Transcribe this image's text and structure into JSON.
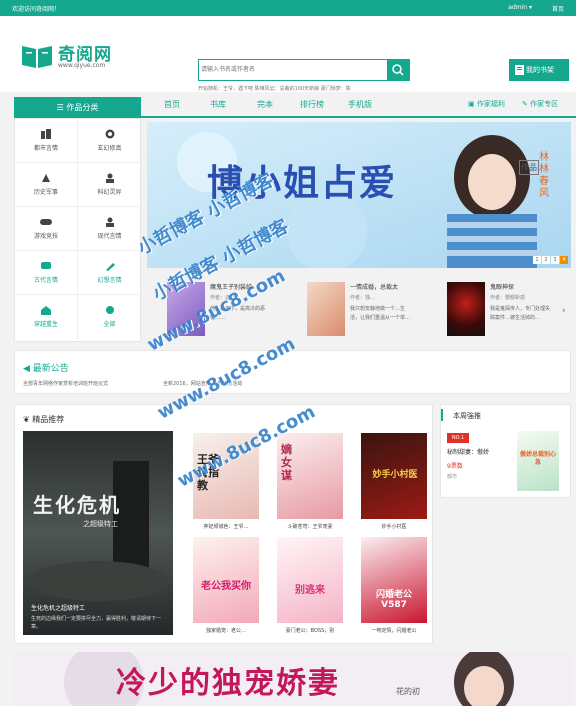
{
  "topbar": {
    "welcome": "欢迎访问奇阅网！",
    "account": "admin ▾",
    "home": "首页"
  },
  "logo": {
    "name": "奇阅网",
    "url": "www.qiyue.com"
  },
  "search": {
    "placeholder": "请输入书名或作者名",
    "hot_words": "开始随机：王爷，遇下吧  陈维风云：总裁的100天新娘 豪门惊梦：陈"
  },
  "shelf": {
    "label": "我的书架"
  },
  "nav": {
    "category": "作品分类",
    "items": [
      "首页",
      "书库",
      "完本",
      "排行榜",
      "手机版"
    ],
    "author_welfare": "作家福利",
    "author_zone": "作家专区"
  },
  "categories": [
    "都市言情",
    "玄幻修真",
    "历史军事",
    "科幻灵异",
    "游戏竞技",
    "现代言情",
    "古代言情",
    "幻想言情",
    "穿越重生",
    "全部"
  ],
  "banner": {
    "title": "博小姐占爱",
    "tag": "作品",
    "author": "林林春风"
  },
  "slider_dots": [
    "1",
    "2",
    "3",
    "4"
  ],
  "featured": [
    {
      "title": "魔鬼王子别装纯",
      "author": "作者：这里",
      "desc": "他，是王子，是高冷的恶魔……"
    },
    {
      "title": "一情成婚，总裁太",
      "author": "作者：独…",
      "desc": "我只想安静地做一个…生活，让我们重温从一个单…"
    },
    {
      "title": "鬼眼神探",
      "author": "作者：酆都斩孤",
      "desc": "我是鬼探传人，专门处理失踪案件…被生活掉的…"
    }
  ],
  "notice": {
    "title": "最新公告",
    "line1": "全部青年网络作家赏析培训班开班仪式",
    "line2": "全新2016，网站宣传 春节特别活动"
  },
  "recommend": {
    "title": "精品推荐",
    "big": {
      "cover_title": "生化危机",
      "cover_sub": "之超级特工",
      "caption": "生化危机之超级特工",
      "desc": "生死的边缘我们一定要拼尽全力，赢得胜利，敬请期待下一章。"
    },
    "books": [
      {
        "title": "王爷请指教",
        "label": "弃妃倾城色：王爷…"
      },
      {
        "title": "嫡女谋",
        "label": "斗破苍穹：王爷宠妻"
      },
      {
        "title": "妙手小村医",
        "label": "妙手小村医"
      },
      {
        "title": "老公我买你",
        "label": "独家婚宠：老公…"
      },
      {
        "title": "别逃来",
        "label": "豪门老公：BOSS，别"
      },
      {
        "title": "闪婚老公 V587",
        "label": "一吻定情，闪婚老公"
      }
    ]
  },
  "weekly": {
    "title": "本周強推",
    "no": "NO.1",
    "name": "秘制甜妻：傲娇",
    "votes": "9票数",
    "cat": "都市",
    "cover": "傲娇总裁别心急"
  },
  "ad": {
    "title": "冷少的独宠娇妻",
    "sub": "花的初"
  },
  "watermark": [
    "小哲博客 小哲博客",
    "小哲博客 小哲博客",
    "www.8uc8.com",
    "www.8uc8.com",
    "www.8uc8.com"
  ],
  "colors": {
    "accent": "#16a88f",
    "notice_red": "#e0302a",
    "highlight": "#f28c00"
  }
}
